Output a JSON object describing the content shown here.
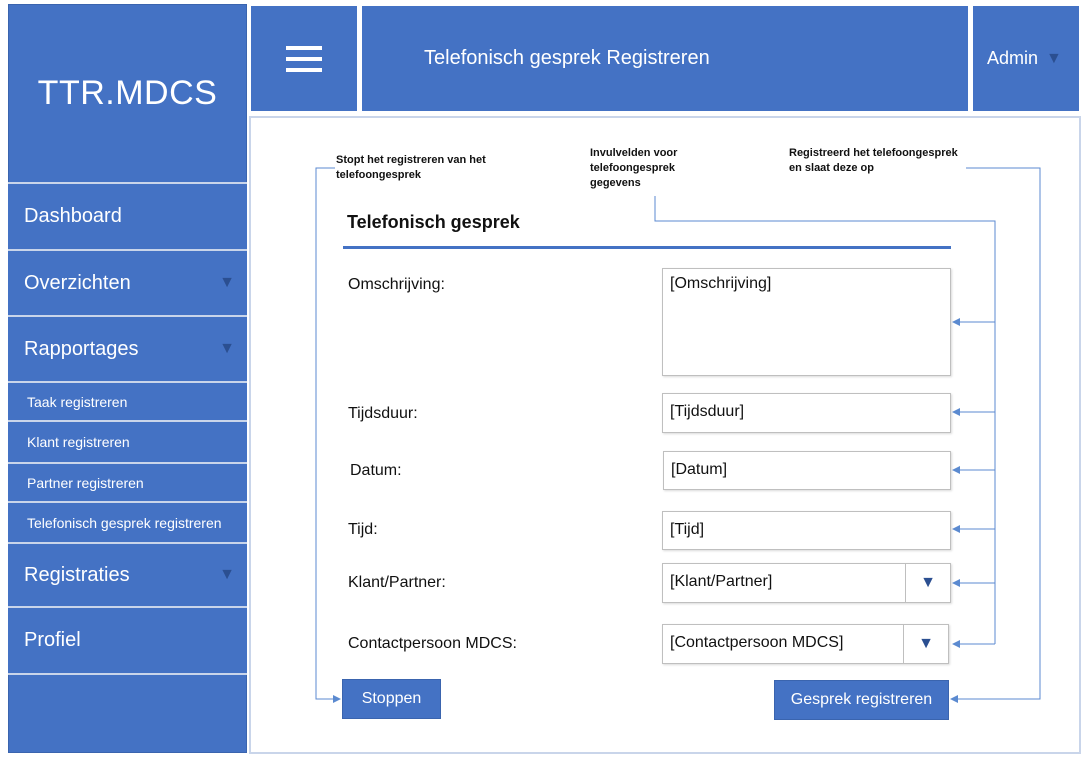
{
  "app": {
    "name": "TTR.MDCS"
  },
  "header": {
    "title": "Telefonisch gesprek Registreren",
    "user": "Admin"
  },
  "sidebar": {
    "items": [
      {
        "label": "Dashboard"
      },
      {
        "label": "Overzichten"
      },
      {
        "label": "Rapportages"
      },
      {
        "label": "Taak registreren"
      },
      {
        "label": "Klant registreren"
      },
      {
        "label": "Partner registreren"
      },
      {
        "label": "Telefonisch gesprek registreren"
      },
      {
        "label": "Registraties"
      },
      {
        "label": "Profiel"
      }
    ]
  },
  "annotations": {
    "stop": "Stopt het registreren van het telefoongesprek",
    "fields": "Invulvelden voor telefoongesprek gegevens",
    "register": "Registreerd het telefoongesprek en slaat deze op"
  },
  "form": {
    "title": "Telefonisch gesprek",
    "omschrijving": {
      "label": "Omschrijving:",
      "value": "[Omschrijving]"
    },
    "tijdsduur": {
      "label": "Tijdsduur:",
      "value": "[Tijdsduur]"
    },
    "datum": {
      "label": "Datum:",
      "value": "[Datum]"
    },
    "tijd": {
      "label": "Tijd:",
      "value": "[Tijd]"
    },
    "klant_partner": {
      "label": "Klant/Partner:",
      "value": "[Klant/Partner]"
    },
    "contactpersoon": {
      "label": "Contactpersoon MDCS:",
      "value": "[Contactpersoon MDCS]"
    },
    "stop_button": "Stoppen",
    "register_button": "Gesprek registreren"
  },
  "colors": {
    "accent": "#4472c4",
    "accent_dark": "#2b4f91",
    "divider": "#c9d5ea"
  },
  "icons": {
    "menu": "hamburger-icon",
    "dropdown": "triangle-down-icon"
  }
}
